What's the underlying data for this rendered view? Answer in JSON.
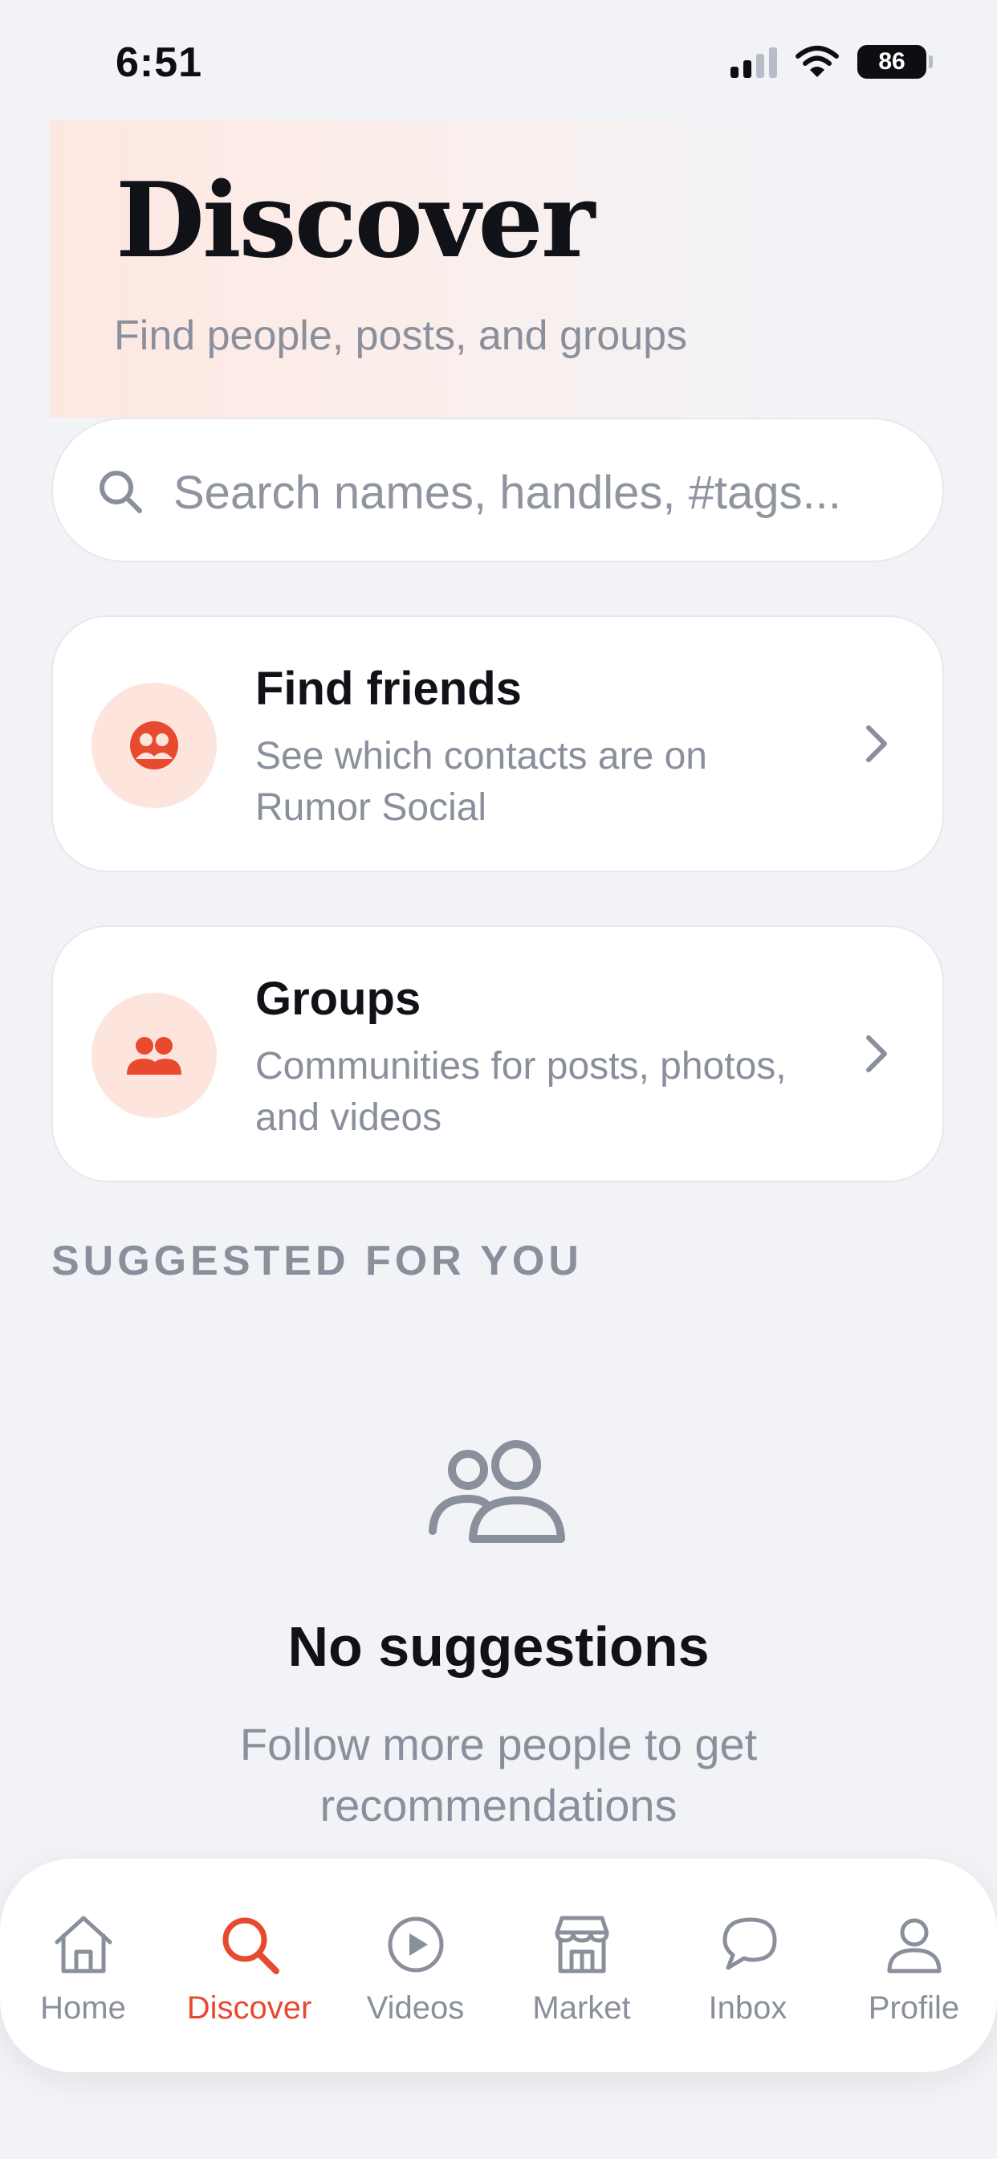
{
  "status_bar": {
    "time": "6:51",
    "battery": "86"
  },
  "header": {
    "title": "Discover",
    "subtitle": "Find people, posts, and groups"
  },
  "search": {
    "placeholder": "Search names, handles, #tags..."
  },
  "cards": [
    {
      "title": "Find friends",
      "description": "See which contacts are on Rumor Social",
      "icon": "contacts-icon"
    },
    {
      "title": "Groups",
      "description": "Communities for posts, photos, and videos",
      "icon": "groups-icon"
    }
  ],
  "section": {
    "label": "SUGGESTED FOR YOU"
  },
  "empty_state": {
    "title": "No suggestions",
    "description": "Follow more people to get recommendations",
    "icon": "people-icon"
  },
  "tab_bar": {
    "tabs": [
      {
        "label": "Home",
        "icon": "home-icon"
      },
      {
        "label": "Discover",
        "icon": "search-icon",
        "active": true
      },
      {
        "label": "Videos",
        "icon": "play-icon"
      },
      {
        "label": "Market",
        "icon": "store-icon"
      },
      {
        "label": "Inbox",
        "icon": "chat-icon"
      },
      {
        "label": "Profile",
        "icon": "profile-icon"
      }
    ]
  },
  "colors": {
    "accent": "#e84a2f",
    "accent_soft": "#fde4dd",
    "muted_text": "#8a8f9c",
    "background": "#f2f3f7"
  }
}
